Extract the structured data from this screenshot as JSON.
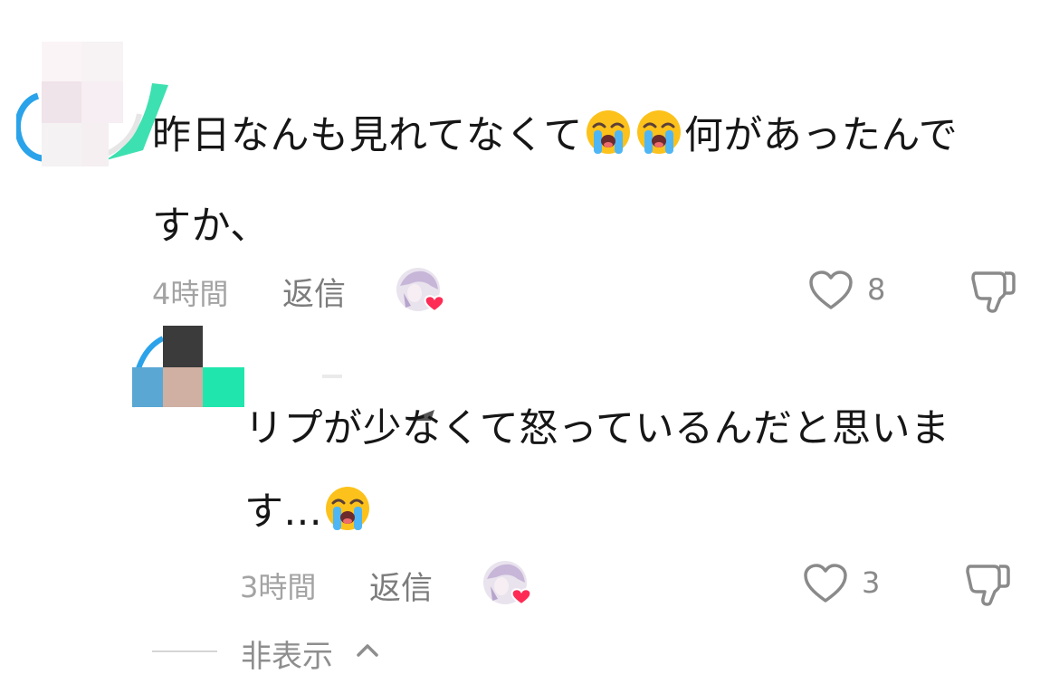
{
  "comments": [
    {
      "text_part1": "昨日なんも見れてなくて",
      "text_part2": "何があったんで",
      "text_line2": "すか、",
      "time": "4時間",
      "reply_label": "返信",
      "likes": "8"
    }
  ],
  "replies": [
    {
      "text_line1": "リプが少なくて怒っているんだと思いま",
      "text_line2": "す...",
      "time": "3時間",
      "reply_label": "返信",
      "likes": "3"
    }
  ],
  "thread": {
    "hide_label": "非表示"
  },
  "icons": {
    "emoji": "loudly-crying-face-icon",
    "like": "heart-outline-icon",
    "dislike": "thumbs-down-icon",
    "creator_like": "creator-liked-avatar-icon",
    "collapse": "chevron-up-icon"
  },
  "colors": {
    "heart_badge": "#fe2c55",
    "time_text": "#a3a3a3",
    "meta_text": "#7c7c7c"
  }
}
